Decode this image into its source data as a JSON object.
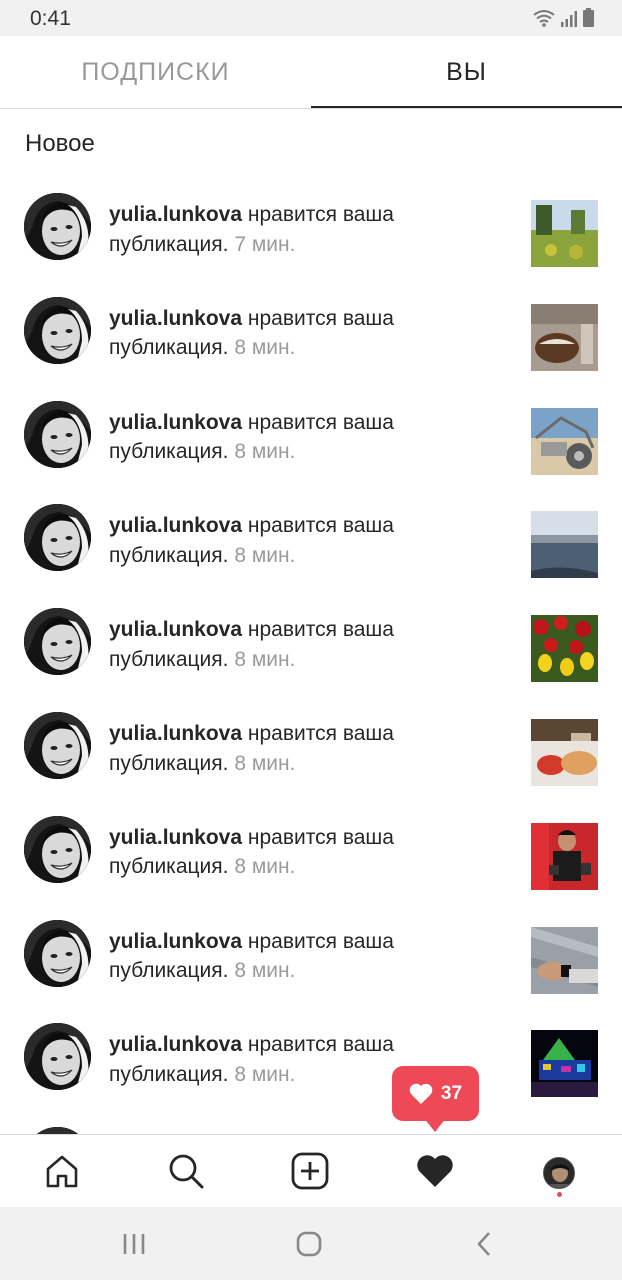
{
  "status_bar": {
    "time": "0:41",
    "icons": [
      "wifi-icon",
      "signal-icon",
      "battery-icon"
    ]
  },
  "tabs": [
    {
      "label": "ПОДПИСКИ",
      "active": false
    },
    {
      "label": "ВЫ",
      "active": true
    }
  ],
  "section_title": "Новое",
  "activity": [
    {
      "user": "yulia.lunkova",
      "action": "нравится ваша публикация.",
      "time": "7 мин.",
      "thumb": "park-photo"
    },
    {
      "user": "yulia.lunkova",
      "action": "нравится ваша публикация.",
      "time": "8 мин.",
      "thumb": "dessert-photo"
    },
    {
      "user": "yulia.lunkova",
      "action": "нравится ваша публикация.",
      "time": "8 мин.",
      "thumb": "vehicle-photo"
    },
    {
      "user": "yulia.lunkova",
      "action": "нравится ваша публикация.",
      "time": "8 мин.",
      "thumb": "river-photo"
    },
    {
      "user": "yulia.lunkova",
      "action": "нравится ваша публикация.",
      "time": "8 мин.",
      "thumb": "tulips-photo"
    },
    {
      "user": "yulia.lunkova",
      "action": "нравится ваша публикация.",
      "time": "8 мин.",
      "thumb": "food-photo"
    },
    {
      "user": "yulia.lunkova",
      "action": "нравится ваша публикация.",
      "time": "8 мин.",
      "thumb": "selfie-photo"
    },
    {
      "user": "yulia.lunkova",
      "action": "нравится ваша публикация.",
      "time": "8 мин.",
      "thumb": "hand-photo"
    },
    {
      "user": "yulia.lunkova",
      "action": "нравится ваша публикация.",
      "time": "8 мин.",
      "thumb": "night-lights-photo"
    }
  ],
  "likes_bubble": {
    "count": "37",
    "color": "#ed4956"
  },
  "bottom_nav": [
    "home-icon",
    "search-icon",
    "add-post-icon",
    "heart-icon",
    "profile-avatar"
  ],
  "system_nav": [
    "recent-apps-icon",
    "home-circle-icon",
    "back-icon"
  ],
  "colors": {
    "accent": "#ed4956",
    "text": "#262626",
    "muted": "#9a9a9a"
  }
}
